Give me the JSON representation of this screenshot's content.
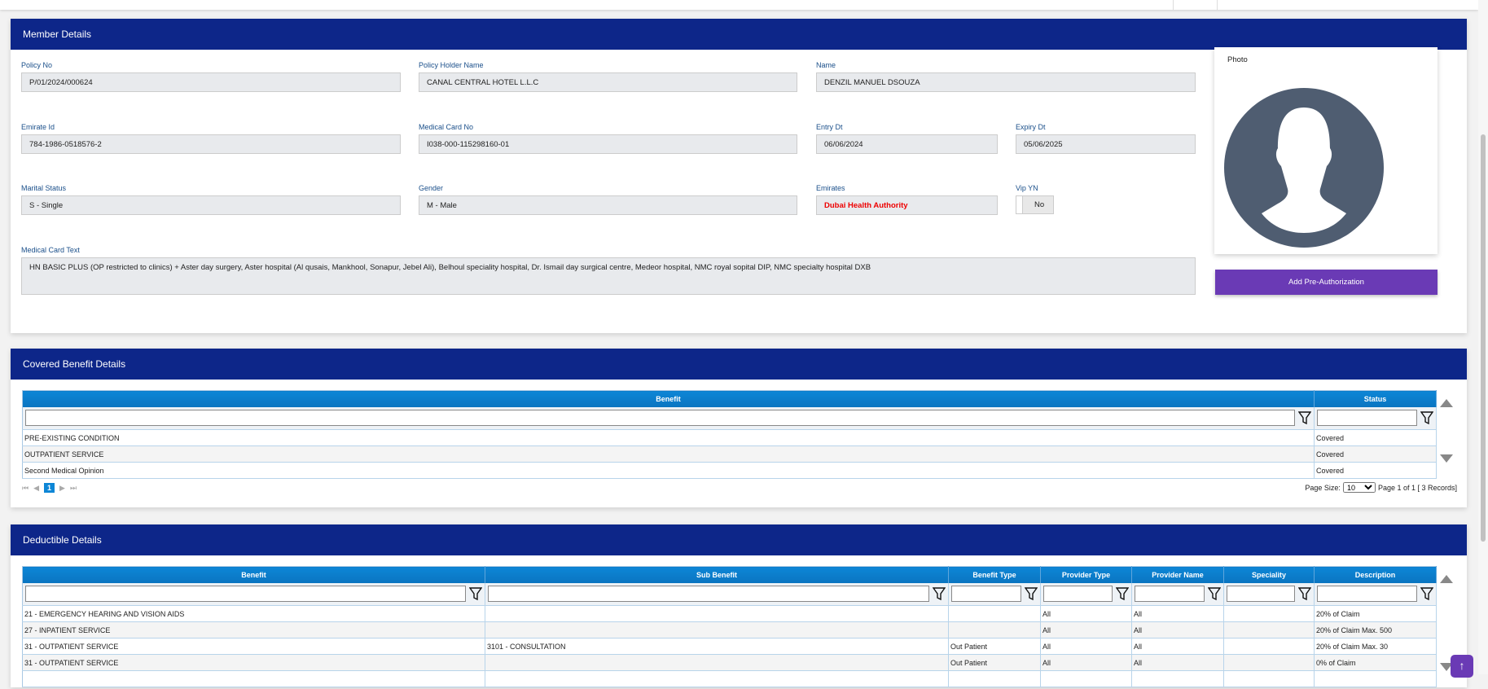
{
  "member": {
    "title": "Member Details",
    "fields": {
      "policy_no": {
        "label": "Policy No",
        "value": "P/01/2024/000624"
      },
      "policy_holder": {
        "label": "Policy Holder Name",
        "value": "CANAL CENTRAL HOTEL L.L.C"
      },
      "name": {
        "label": "Name",
        "value": "DENZIL MANUEL  DSOUZA"
      },
      "emirate_id": {
        "label": "Emirate Id",
        "value": "784-1986-0518576-2"
      },
      "medical_card_no": {
        "label": "Medical Card No",
        "value": "I038-000-115298160-01"
      },
      "entry_dt": {
        "label": "Entry Dt",
        "value": "06/06/2024"
      },
      "expiry_dt": {
        "label": "Expiry Dt",
        "value": "05/06/2025"
      },
      "marital_status": {
        "label": "Marital Status",
        "value": "S - Single"
      },
      "gender": {
        "label": "Gender",
        "value": "M - Male"
      },
      "emirates": {
        "label": "Emirates",
        "value": "Dubai Health Authority"
      },
      "vip": {
        "label": "Vip YN",
        "value": "No"
      },
      "medical_card_text": {
        "label": "Medical Card Text",
        "value": "HN BASIC PLUS (OP restricted to clinics) + Aster day surgery, Aster hospital (Al qusais, Mankhool, Sonapur, Jebel Ali), Belhoul speciality hospital, Dr. Ismail day surgical centre, Medeor hospital, NMC royal sopital DIP,  NMC specialty hospital DXB"
      }
    },
    "photo_label": "Photo",
    "add_preauth": "Add Pre-Authorization"
  },
  "covered": {
    "title": "Covered Benefit Details",
    "columns": [
      "Benefit",
      "Status"
    ],
    "rows": [
      [
        "PRE-EXISTING CONDITION",
        "Covered"
      ],
      [
        "OUTPATIENT SERVICE",
        "Covered"
      ],
      [
        "Second Medical Opinion",
        "Covered"
      ]
    ],
    "pager": {
      "page": "1",
      "page_size_label": "Page Size:",
      "page_size": "10",
      "summary": "Page 1 of 1 [ 3 Records]"
    }
  },
  "deductible": {
    "title": "Deductible Details",
    "columns": [
      "Benefit",
      "Sub Benefit",
      "Benefit Type",
      "Provider Type",
      "Provider Name",
      "Speciality",
      "Description"
    ],
    "rows": [
      [
        "21 - EMERGENCY HEARING AND VISION AIDS",
        "",
        "",
        "All",
        "All",
        "",
        "20% of Claim"
      ],
      [
        "27 - INPATIENT SERVICE",
        "",
        "",
        "All",
        "All",
        "",
        "20% of Claim Max. 500"
      ],
      [
        "31 - OUTPATIENT SERVICE",
        "3101 - CONSULTATION",
        "Out Patient",
        "All",
        "All",
        "",
        "20% of Claim Max. 30"
      ],
      [
        "31 - OUTPATIENT SERVICE",
        "",
        "Out Patient",
        "All",
        "All",
        "",
        "0% of Claim"
      ],
      [
        "",
        "",
        "",
        "",
        "",
        "",
        ""
      ]
    ]
  },
  "colors": {
    "header": "#0d2689",
    "accent": "#6a3ab5",
    "grid_header": "#0a7bc8"
  }
}
